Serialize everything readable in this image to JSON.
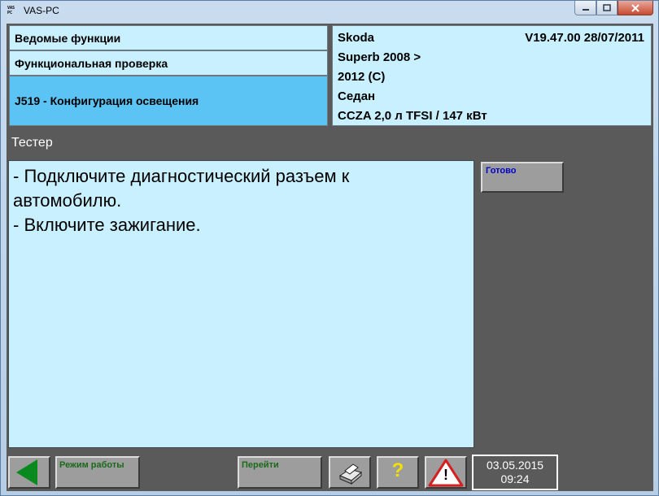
{
  "window": {
    "title": "VAS-PC",
    "icon": "vas-pc-app-icon",
    "icon_text": [
      "VAS",
      "PC"
    ]
  },
  "header": {
    "left": [
      {
        "label": "Ведомые функции"
      },
      {
        "label": "Функциональная проверка"
      },
      {
        "label": "J519 - Конфигурация освещения"
      }
    ],
    "vehicle": {
      "brand": "Skoda",
      "version": "V19.47.00 28/07/2011",
      "model": "Superb 2008 >",
      "years": "2012 (C)",
      "body": "Седан",
      "engine": "CCZA 2,0 л TFSI / 147 кВт"
    }
  },
  "panel": {
    "label": "Тестер",
    "message": [
      "- Подключите диагностический разъем к",
      "автомобилю.",
      "- Включите зажигание."
    ],
    "done_button": "Готово"
  },
  "footer": {
    "mode_button": "Режим работы",
    "goto_button": "Перейти",
    "help_symbol": "?",
    "warning_symbol": "!",
    "date": "03.05.2015",
    "time": "09:24"
  },
  "colors": {
    "panel_bg": "#c8f0fe",
    "selected_row": "#5bc4f4",
    "frame_bg": "#5a5a5a",
    "back_arrow": "#0a8a1e",
    "button_label": "#1a6a1a",
    "done_label": "#0000cc"
  },
  "icons": [
    "back-arrow-icon",
    "printer-icon",
    "help-icon",
    "warning-icon",
    "minimize-icon",
    "maximize-icon",
    "close-icon"
  ]
}
